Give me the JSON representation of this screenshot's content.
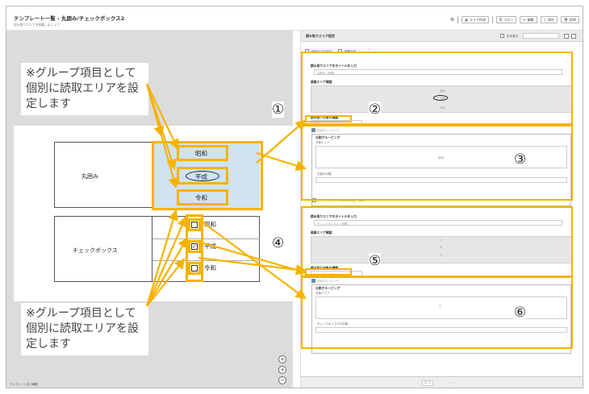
{
  "header": {
    "breadcrumb": "テンプレート一覧 › 丸囲み/チェックボックス2",
    "subtitle": "読み取りエリアを編集しましょう",
    "buttons": [
      "エリア作成",
      "コピー",
      "編集",
      "保存",
      "削除"
    ]
  },
  "left": {
    "table1": {
      "label": "丸囲み",
      "options": [
        "昭和",
        "平成",
        "令和"
      ],
      "selected": "平成"
    },
    "table2": {
      "label": "チェックボックス",
      "options": [
        "昭和",
        "平成",
        "令和"
      ],
      "checked": "平成"
    },
    "note": "※グループ項目として個別に読取エリアを設定します",
    "zoom": [
      "+",
      "+",
      "−"
    ],
    "footer": "テンプレート名の編集"
  },
  "right": {
    "panel_title": "読み取りエリア設定",
    "opt_a": "読取方法を指定",
    "opt_b": "帳票全体",
    "opt_c": "矢印表示",
    "group1": {
      "title": "読み取りエリアのタイトルを入力",
      "title_value": "丸囲み（和暦）",
      "image_label": "画像エリア確認",
      "thumb_top": "昭和",
      "thumb_mid": "平成",
      "thumb_bot": "令和",
      "type_label": "読み取り対象の種類",
      "type_value": "丸囲み",
      "grouping_check": "分割グルーピング",
      "grouping_title": "分割グルーピング",
      "area_label": "分割エリア",
      "area_name": "昭和",
      "item_label": "分割の対象",
      "bottom_check": "チェックボックスの枠線を検出（単数）"
    },
    "group2": {
      "title": "読み取りエリアのタイトルを入力",
      "title_value": "チェックボックス（和暦）",
      "image_label": "画像エリア確認",
      "type_label": "読み取り対象の種類",
      "type_value": "チェックボックス",
      "grouping_check": "分割グルーピング",
      "grouping_title": "分割グルーピング",
      "area_label": "分割エリア",
      "item_label": "チェックボックスの対象"
    },
    "pager": "1 / 1"
  },
  "annotations": [
    "①",
    "②",
    "③",
    "④",
    "⑤",
    "⑥"
  ],
  "accent": "#f5b300"
}
